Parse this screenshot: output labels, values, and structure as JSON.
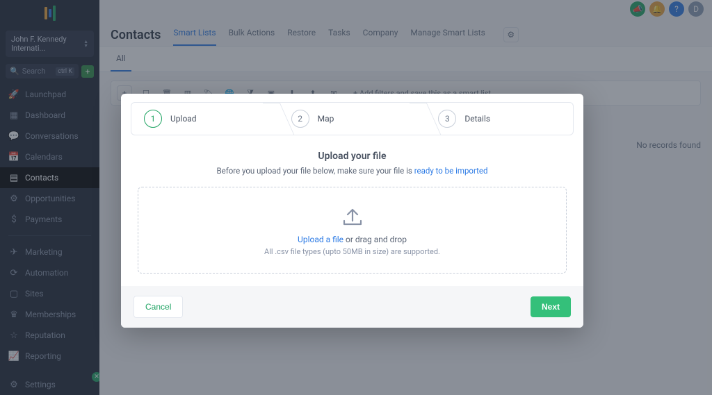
{
  "account": {
    "name": "John F. Kennedy Internati..."
  },
  "search": {
    "placeholder": "Search",
    "kbd": "ctrl K"
  },
  "sidebar": {
    "items": [
      {
        "label": "Launchpad",
        "icon": "🚀"
      },
      {
        "label": "Dashboard",
        "icon": "▦"
      },
      {
        "label": "Conversations",
        "icon": "💬"
      },
      {
        "label": "Calendars",
        "icon": "📅"
      },
      {
        "label": "Contacts",
        "icon": "▤"
      },
      {
        "label": "Opportunities",
        "icon": "⚙"
      },
      {
        "label": "Payments",
        "icon": "$"
      }
    ],
    "items2": [
      {
        "label": "Marketing",
        "icon": "✈"
      },
      {
        "label": "Automation",
        "icon": "⟳"
      },
      {
        "label": "Sites",
        "icon": "▢"
      },
      {
        "label": "Memberships",
        "icon": "♛"
      },
      {
        "label": "Reputation",
        "icon": "☆"
      },
      {
        "label": "Reporting",
        "icon": "📈"
      }
    ],
    "settings": {
      "label": "Settings",
      "icon": "⚙"
    }
  },
  "page": {
    "title": "Contacts",
    "subtabs": [
      "Smart Lists",
      "Bulk Actions",
      "Restore",
      "Tasks",
      "Company",
      "Manage Smart Lists"
    ],
    "filter_tab": "All",
    "toolbar_hint": "+ Add filters and save this as a smart list",
    "no_records": "No records found"
  },
  "modal": {
    "steps": [
      {
        "num": "1",
        "label": "Upload"
      },
      {
        "num": "2",
        "label": "Map"
      },
      {
        "num": "3",
        "label": "Details"
      }
    ],
    "title": "Upload your file",
    "sub_prefix": "Before you upload your file below, make sure your file is ",
    "sub_link": "ready to be imported",
    "drop_link": "Upload a file",
    "drop_suffix": " or drag and drop",
    "drop_hint": "All .csv file types (upto 50MB in size) are supported.",
    "cancel": "Cancel",
    "next": "Next"
  },
  "topicons": {
    "avatar": "D"
  }
}
